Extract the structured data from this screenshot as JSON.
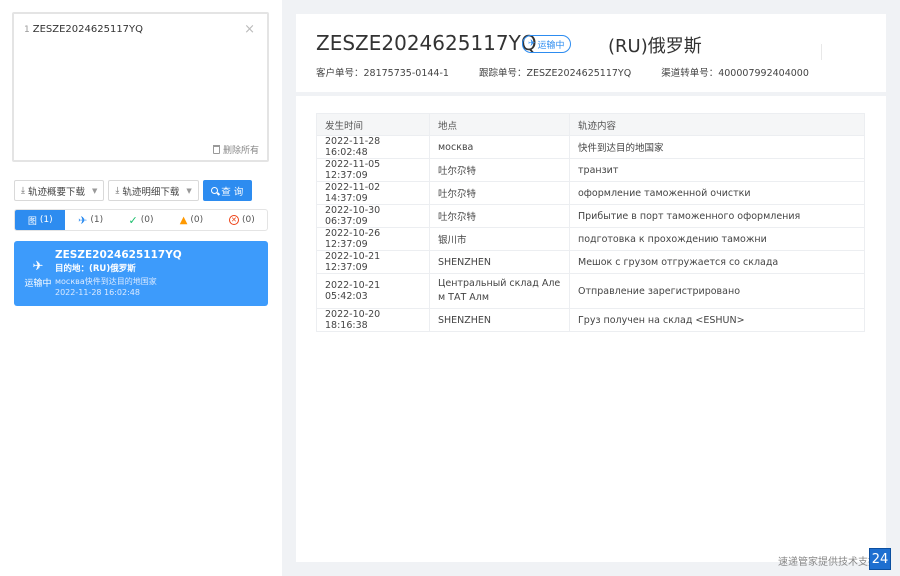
{
  "query_box": {
    "line_number": "1",
    "value": "ZESZE2024625117YQ",
    "clear_icon": "close-icon",
    "delete_all_label": "删除所有"
  },
  "toolbar": {
    "summary_download_label": "轨迹概要下载",
    "detail_download_label": "轨迹明细下载",
    "search_label": "查 询"
  },
  "status_tabs": [
    {
      "label": "(1)",
      "prefix": "图",
      "icon": "all-icon",
      "active": true
    },
    {
      "label": "(1)",
      "icon": "plane-icon"
    },
    {
      "label": "(0)",
      "icon": "check-icon"
    },
    {
      "label": "(0)",
      "icon": "warning-icon"
    },
    {
      "label": "(0)",
      "icon": "error-icon"
    }
  ],
  "shipment_card": {
    "status": "运输中",
    "number": "ZESZE2024625117YQ",
    "destination": "目的地：(RU)俄罗斯",
    "last_event": "москва快件到达目的地国家",
    "time": "2022-11-28 16:02:48"
  },
  "header": {
    "tracking_number": "ZESZE2024625117YQ",
    "status_tag": "运输中",
    "destination": "(RU)俄罗斯",
    "customer_no": "客户单号：28175735-0144-1",
    "tracking_no": "跟踪单号：ZESZE2024625117YQ",
    "channel_no": "渠道转单号：400007992404000"
  },
  "table": {
    "headers": [
      "发生时间",
      "地点",
      "轨迹内容"
    ],
    "rows": [
      [
        "2022-11-28 16:02:48",
        "москва",
        "快件到达目的地国家"
      ],
      [
        "2022-11-05 12:37:09",
        "吐尔尕特",
        "транзит"
      ],
      [
        "2022-11-02 14:37:09",
        "吐尔尕特",
        "оформление таможенной очистки"
      ],
      [
        "2022-10-30 06:37:09",
        "吐尔尕特",
        "Прибытие в порт таможенного оформления"
      ],
      [
        "2022-10-26 12:37:09",
        "银川市",
        "подготовка к прохождению таможни"
      ],
      [
        "2022-10-21 12:37:09",
        "SHENZHEN",
        "Мешок с грузом отгружается со склада"
      ],
      [
        "2022-10-21 05:42:03",
        "Центральный склад Але м ТАТ Алм",
        "Отправление зарегистрировано"
      ],
      [
        "2022-10-20 18:16:38",
        "SHENZHEN",
        "Груз получен на склад <ESHUN>"
      ]
    ]
  },
  "footer": {
    "note": "速递管家提供技术支持",
    "badge": "24"
  },
  "colors": {
    "accent": "#2d8cf0",
    "card": "#3d9bfb"
  }
}
